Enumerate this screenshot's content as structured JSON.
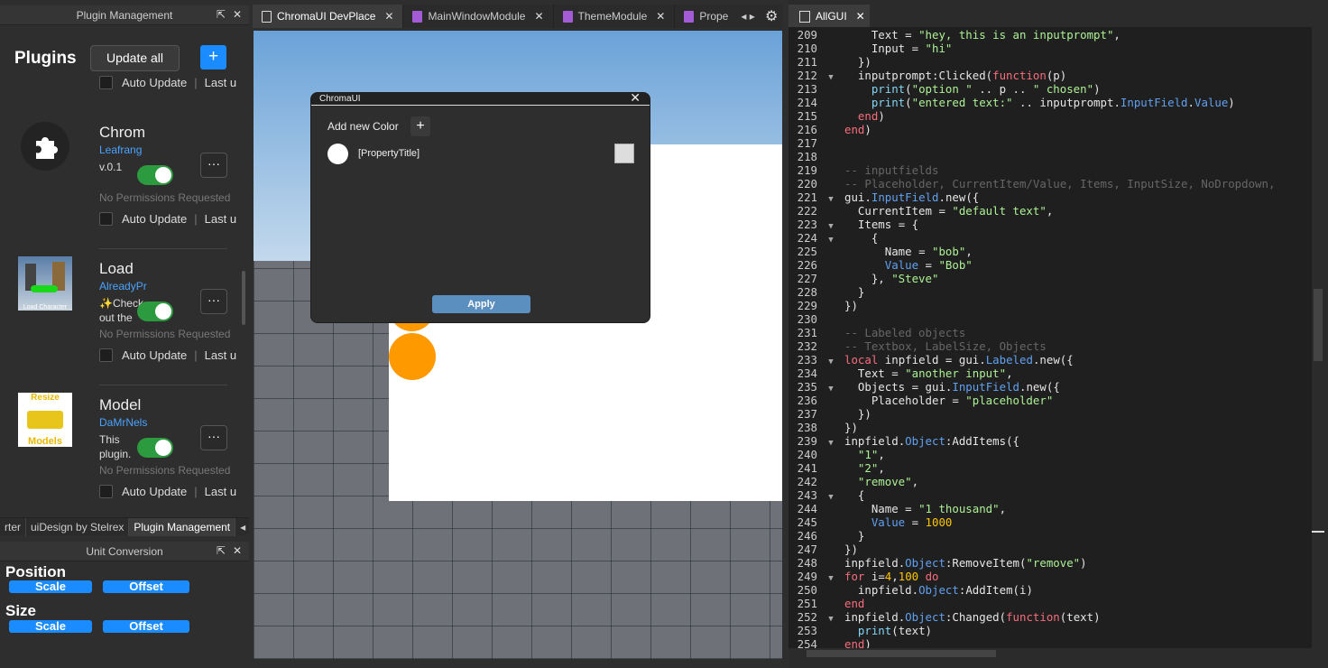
{
  "plugin_panel": {
    "title": "Plugin Management",
    "heading": "Plugins",
    "update_all": "Update all",
    "add": "+",
    "plugins": [
      {
        "name": "",
        "author": "",
        "desc": "",
        "perm": "",
        "auto": "Auto Update",
        "last": "Last u"
      },
      {
        "name": "Chrom",
        "author": "Leafrang",
        "desc": "v.0.1",
        "perm": "No Permissions Requested",
        "auto": "Auto Update",
        "last": "Last u"
      },
      {
        "name": "Load",
        "author": "AlreadyPr",
        "desc": "✨Check out the",
        "perm": "No Permissions Requested",
        "auto": "Auto Update",
        "last": "Last u"
      },
      {
        "name": "Model",
        "author": "DaMrNels",
        "desc": "This plugin.",
        "perm": "No Permissions Requested",
        "auto": "Auto Update",
        "last": "Last u"
      }
    ],
    "icon_texts": {
      "load": "Load Character",
      "resize_top": "Resize",
      "resize_bottom": "Models"
    }
  },
  "bottom_tabs": [
    "rter",
    "uiDesign by Stelrex",
    "Plugin Management"
  ],
  "unit_panel": {
    "title": "Unit Conversion",
    "position": "Position",
    "size": "Size",
    "scale": "Scale",
    "offset": "Offset"
  },
  "tabs": [
    {
      "label": "ChromaUI DevPlace"
    },
    {
      "label": "MainWindowModule"
    },
    {
      "label": "ThemeModule"
    },
    {
      "label": "Prope"
    }
  ],
  "editor_tab": "AllGUI",
  "dialog": {
    "title": "ChromaUI",
    "add_color": "Add new Color",
    "property_title": "[PropertyTitle]",
    "apply": "Apply"
  },
  "code_lines": [
    {
      "n": "209",
      "t": "    Text = \"hey, this is an inputprompt\","
    },
    {
      "n": "210",
      "t": "    Input = \"hi\""
    },
    {
      "n": "211",
      "t": "  })"
    },
    {
      "n": "212",
      "t": "  inputprompt:Clicked(function(p)"
    },
    {
      "n": "213",
      "t": "    print(\"option \" .. p .. \" chosen\")"
    },
    {
      "n": "214",
      "t": "    print(\"entered text:\" .. inputprompt.InputField.Value)"
    },
    {
      "n": "215",
      "t": "  end)"
    },
    {
      "n": "216",
      "t": "end)"
    },
    {
      "n": "217",
      "t": ""
    },
    {
      "n": "218",
      "t": ""
    },
    {
      "n": "219",
      "t": "-- inputfields"
    },
    {
      "n": "220",
      "t": "-- Placeholder, CurrentItem/Value, Items, InputSize, NoDropdown,"
    },
    {
      "n": "221",
      "t": "gui.InputField.new({"
    },
    {
      "n": "222",
      "t": "  CurrentItem = \"default text\","
    },
    {
      "n": "223",
      "t": "  Items = {"
    },
    {
      "n": "224",
      "t": "    {"
    },
    {
      "n": "225",
      "t": "      Name = \"bob\","
    },
    {
      "n": "226",
      "t": "      Value = \"Bob\""
    },
    {
      "n": "227",
      "t": "    }, \"Steve\""
    },
    {
      "n": "228",
      "t": "  }"
    },
    {
      "n": "229",
      "t": "})"
    },
    {
      "n": "230",
      "t": ""
    },
    {
      "n": "231",
      "t": "-- Labeled objects"
    },
    {
      "n": "232",
      "t": "-- Textbox, LabelSize, Objects"
    },
    {
      "n": "233",
      "t": "local inpfield = gui.Labeled.new({"
    },
    {
      "n": "234",
      "t": "  Text = \"another input\","
    },
    {
      "n": "235",
      "t": "  Objects = gui.InputField.new({"
    },
    {
      "n": "236",
      "t": "    Placeholder = \"placeholder\""
    },
    {
      "n": "237",
      "t": "  })"
    },
    {
      "n": "238",
      "t": "})"
    },
    {
      "n": "239",
      "t": "inpfield.Object:AddItems({"
    },
    {
      "n": "240",
      "t": "  \"1\","
    },
    {
      "n": "241",
      "t": "  \"2\","
    },
    {
      "n": "242",
      "t": "  \"remove\","
    },
    {
      "n": "243",
      "t": "  {"
    },
    {
      "n": "244",
      "t": "    Name = \"1 thousand\","
    },
    {
      "n": "245",
      "t": "    Value = 1000"
    },
    {
      "n": "246",
      "t": "  }"
    },
    {
      "n": "247",
      "t": "})"
    },
    {
      "n": "248",
      "t": "inpfield.Object:RemoveItem(\"remove\")"
    },
    {
      "n": "249",
      "t": "for i=4,100 do"
    },
    {
      "n": "250",
      "t": "  inpfield.Object:AddItem(i)"
    },
    {
      "n": "251",
      "t": "end"
    },
    {
      "n": "252",
      "t": "inpfield.Object:Changed(function(text)"
    },
    {
      "n": "253",
      "t": "  print(text)"
    },
    {
      "n": "254",
      "t": "end)"
    }
  ],
  "fold_lines": [
    "212",
    "221",
    "223",
    "224",
    "233",
    "235",
    "239",
    "243",
    "249",
    "252"
  ],
  "colors": {
    "accent": "#1a8cff",
    "toggle": "#2c9a3e",
    "orange": "#ff9900",
    "author": "#4aa3ff"
  }
}
